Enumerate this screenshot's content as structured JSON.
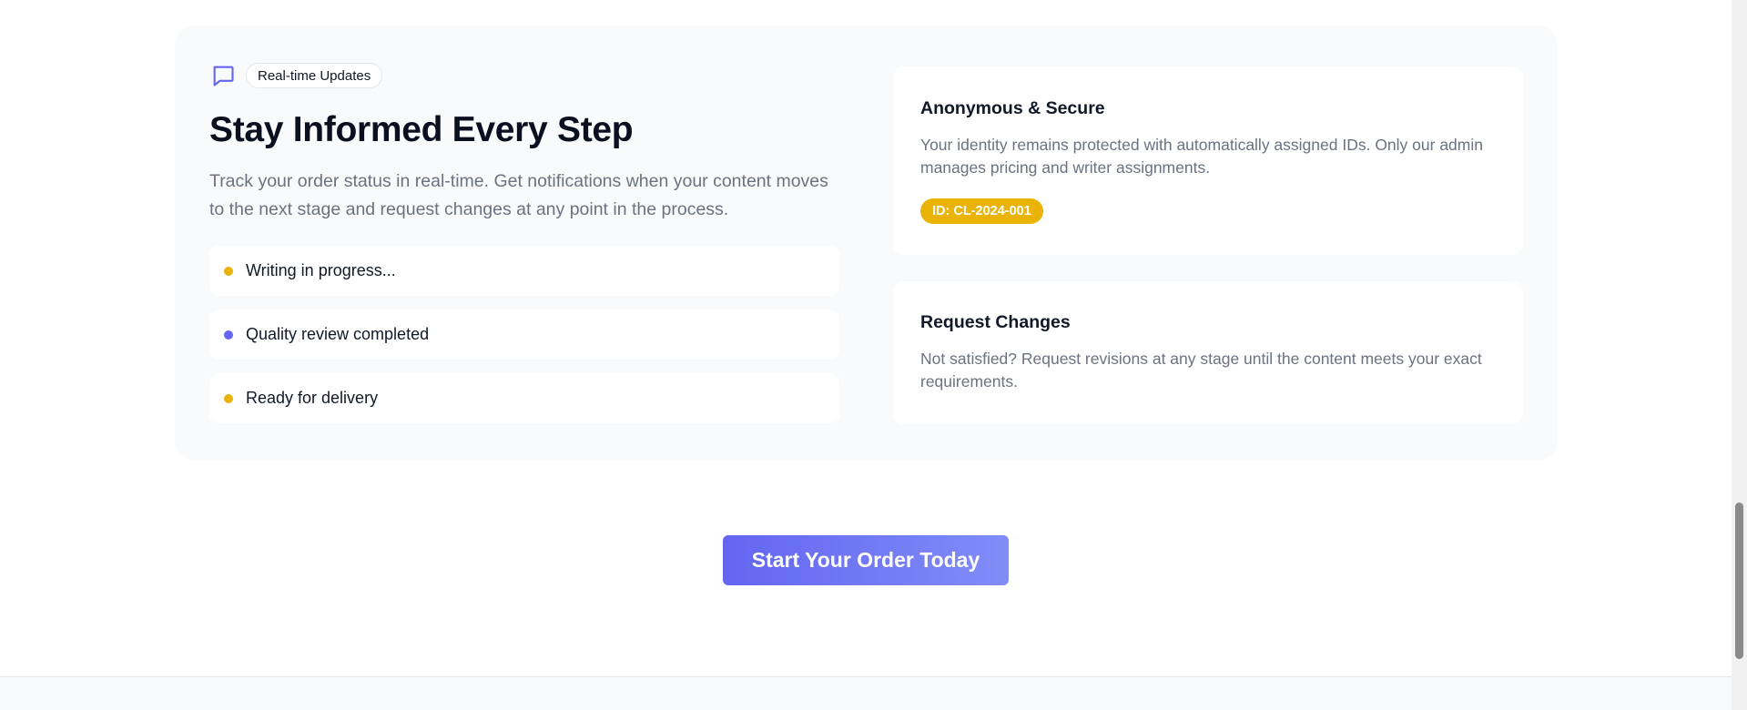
{
  "section": {
    "badge_icon": "chat-icon",
    "badge_label": "Real-time Updates",
    "headline": "Stay Informed Every Step",
    "lead": "Track your order status in real-time. Get notifications when your content moves to the next stage and request changes at any point in the process.",
    "status_items": [
      {
        "label": "Writing in progress...",
        "dot_color": "#eab308"
      },
      {
        "label": "Quality review completed",
        "dot_color": "#6366f1"
      },
      {
        "label": "Ready for delivery",
        "dot_color": "#eab308"
      }
    ]
  },
  "cards": {
    "anonymous": {
      "title": "Anonymous & Secure",
      "text": "Your identity remains protected with automatically assigned IDs. Only our admin manages pricing and writer assignments.",
      "id_badge": "ID: CL-2024-001"
    },
    "changes": {
      "title": "Request Changes",
      "text": "Not satisfied? Request revisions at any stage until the content meets your exact requirements."
    }
  },
  "cta": {
    "label": "Start Your Order Today"
  },
  "colors": {
    "accent": "#6366f1",
    "accent_light": "#818cf8",
    "highlight": "#eab308",
    "muted_text": "#6b7280",
    "panel_bg": "#f9fafb"
  }
}
